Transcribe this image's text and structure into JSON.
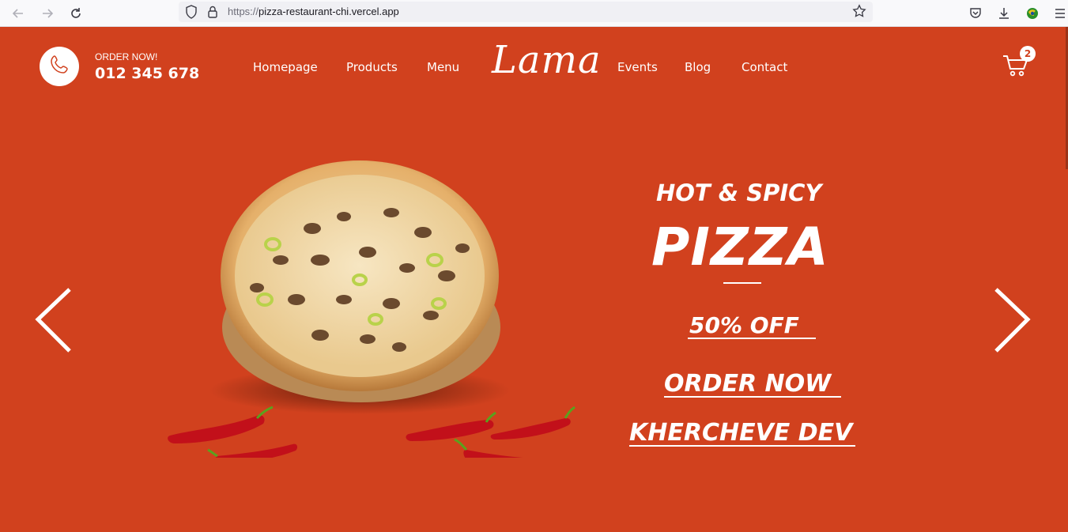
{
  "browser": {
    "url_scheme": "https://",
    "url_host": "pizza-restaurant-chi.vercel.app",
    "icons": [
      "back-icon",
      "forward-icon",
      "reload-icon",
      "shield-icon",
      "lock-icon",
      "star-icon",
      "pocket-icon",
      "download-icon",
      "extension-icon",
      "menu-icon"
    ]
  },
  "header": {
    "order_label": "ORDER NOW!",
    "phone": "012 345 678",
    "nav": {
      "homepage": "Homepage",
      "products": "Products",
      "menu": "Menu",
      "logo": "Lama",
      "events": "Events",
      "blog": "Blog",
      "contact": "Contact"
    },
    "cart_count": "2"
  },
  "hero": {
    "subtitle": "HOT & SPICY",
    "title": "PIZZA",
    "offer": "50% OFF",
    "cta": "ORDER NOW",
    "author": "KHERCHEVE DEV"
  },
  "colors": {
    "brand": "#d1411e",
    "text": "#ffffff"
  }
}
